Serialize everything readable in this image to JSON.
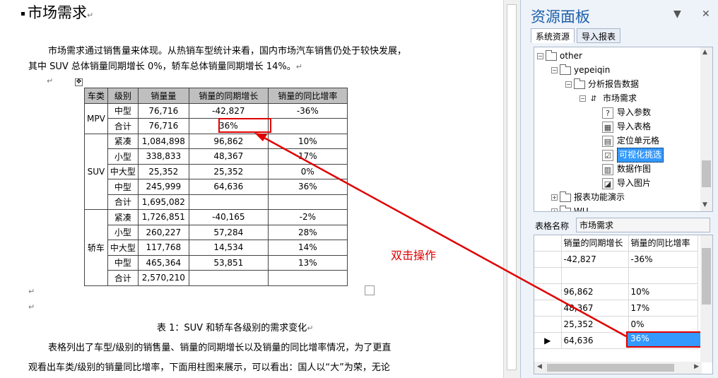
{
  "doc": {
    "heading": "市场需求",
    "para1_line1": "市场需求通过销售量来体现。从热销车型统计来看，国内市场汽车销售仍处于较快发展，",
    "para1_line2": "其中 SUV 总体销量同期增长 0%，轿车总体销量同期增长 14%。",
    "para_mark": "↵",
    "caption": "表 1：SUV 和轿车各级别的需求变化",
    "para2_line1": "表格列出了车型/级别的销售量、销量的同期增长以及销量的同比增率情况，为了更直",
    "para2_line2": "观看出车类/级别的销量同比增率，下面用柱图来展示，可以看出：国人以“大”为荣，无论",
    "table": {
      "headers": [
        "车类",
        "级别",
        "销量量",
        "销量的同期增长",
        "销量的同比增率"
      ],
      "groups": [
        {
          "category": "MPV",
          "rows": [
            {
              "level": "中型",
              "sales": "76,716",
              "growth": "-42,827",
              "rate": "-36%"
            },
            {
              "level": "合计",
              "sales": "76,716",
              "growth": "36%",
              "rate": ""
            }
          ]
        },
        {
          "category": "SUV",
          "rows": [
            {
              "level": "紧凑",
              "sales": "1,084,898",
              "growth": "96,862",
              "rate": "10%"
            },
            {
              "level": "小型",
              "sales": "338,833",
              "growth": "48,367",
              "rate": "17%"
            },
            {
              "level": "中大型",
              "sales": "25,352",
              "growth": "25,352",
              "rate": "0%"
            },
            {
              "level": "中型",
              "sales": "245,999",
              "growth": "64,636",
              "rate": "36%"
            },
            {
              "level": "合计",
              "sales": "1,695,082",
              "growth": "",
              "rate": ""
            }
          ]
        },
        {
          "category": "轿车",
          "rows": [
            {
              "level": "紧凑",
              "sales": "1,726,851",
              "growth": "-40,165",
              "rate": "-2%"
            },
            {
              "level": "小型",
              "sales": "260,227",
              "growth": "57,284",
              "rate": "28%"
            },
            {
              "level": "中大型",
              "sales": "117,768",
              "growth": "14,534",
              "rate": "14%"
            },
            {
              "level": "中型",
              "sales": "465,364",
              "growth": "53,851",
              "rate": "13%"
            },
            {
              "level": "合计",
              "sales": "2,570,210",
              "growth": "",
              "rate": ""
            }
          ]
        }
      ]
    }
  },
  "annotation": "双击操作",
  "panel": {
    "title": "资源面板",
    "pin": "▼",
    "close": "✕",
    "tabs": [
      "系统资源",
      "导入报表"
    ],
    "tree": [
      {
        "label": "other",
        "icon": "folder"
      },
      {
        "label": "yepeiqin",
        "icon": "folder"
      },
      {
        "label": "分析报告数据",
        "icon": "folder"
      },
      {
        "label": "市场需求",
        "icon": "report"
      },
      {
        "label": "导入参数",
        "icon": "?"
      },
      {
        "label": "导入表格",
        "icon": "▦"
      },
      {
        "label": "定位单元格",
        "icon": "▤"
      },
      {
        "label": "可视化挑选",
        "icon": "☑"
      },
      {
        "label": "数据作图",
        "icon": "▥"
      },
      {
        "label": "导入图片",
        "icon": "◪"
      },
      {
        "label": "报表功能演示",
        "icon": "folder"
      },
      {
        "label": "WU",
        "icon": "folder"
      }
    ],
    "table_name_label": "表格名称",
    "table_name_value": "市场需求",
    "grid": {
      "headers": [
        "销量的同期增长",
        "销量的同比增率"
      ],
      "rows": [
        [
          "-42,827",
          "-36%"
        ],
        [
          "",
          ""
        ],
        [
          "96,862",
          "10%"
        ],
        [
          "48,367",
          "17%"
        ],
        [
          "25,352",
          "0%"
        ],
        [
          "64,636",
          "36%"
        ]
      ],
      "current_row_marker": "▶"
    }
  },
  "colors": {
    "accent": "#1e5fa8",
    "highlight": "#e00000",
    "selection": "#3399ff"
  }
}
